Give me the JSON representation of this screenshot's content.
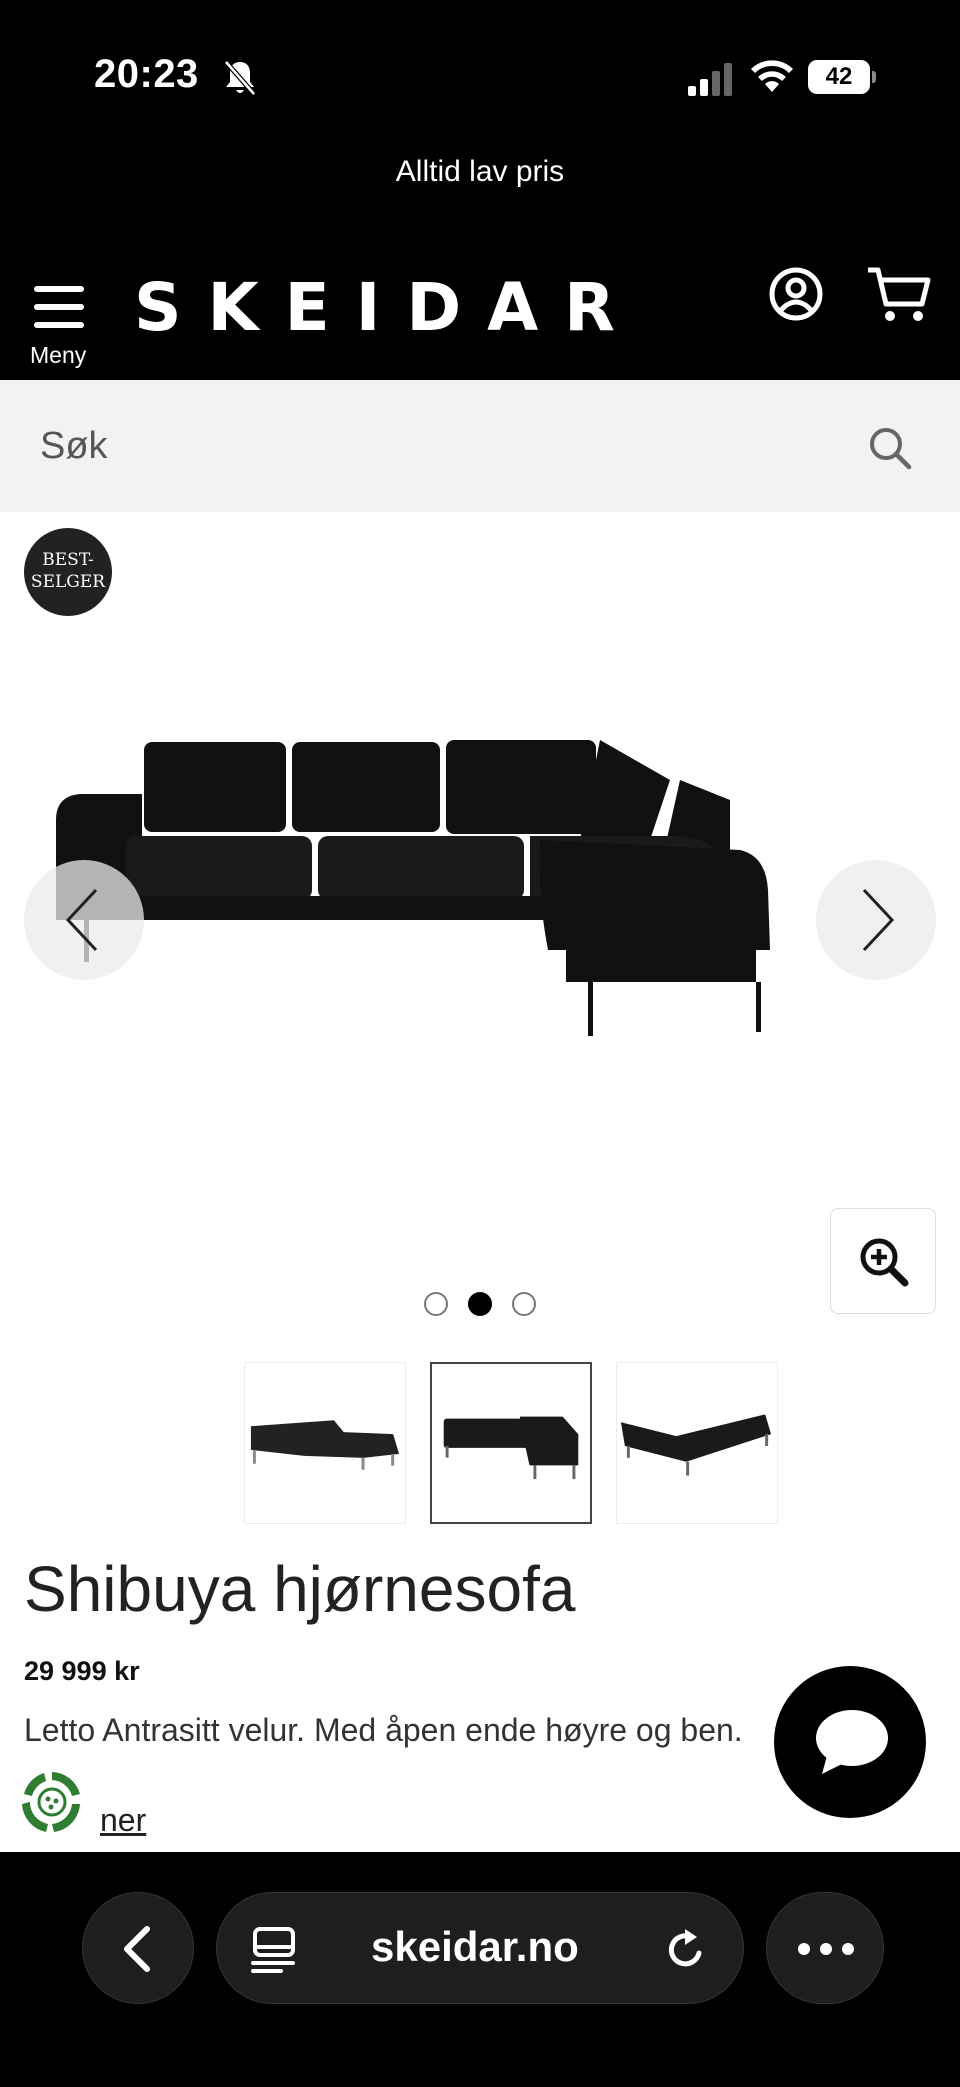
{
  "status_bar": {
    "time": "20:23",
    "battery": "42"
  },
  "announcement": "Alltid lav pris",
  "header": {
    "menu_label": "Meny",
    "logo": "SKEIDAR"
  },
  "search": {
    "placeholder": "Søk"
  },
  "badge": {
    "line1": "BEST-",
    "line2": "SELGER"
  },
  "product": {
    "title": "Shibuya hjørnesofa",
    "price": "29 999 kr",
    "description": "Letto Antrasitt velur. Med åpen ende høyre og ben.",
    "read_more": "ner",
    "color": "#111111"
  },
  "gallery": {
    "dots": 3,
    "active_index": 1
  },
  "browser": {
    "url": "skeidar.no"
  },
  "icons": [
    "bell-off-icon",
    "signal-icon",
    "wifi-icon",
    "battery-icon",
    "menu-icon",
    "account-icon",
    "cart-icon",
    "search-icon",
    "chevron-left-icon",
    "chevron-right-icon",
    "zoom-in-icon",
    "chat-icon",
    "eco-icon",
    "tabs-icon",
    "reload-icon",
    "more-icon"
  ]
}
